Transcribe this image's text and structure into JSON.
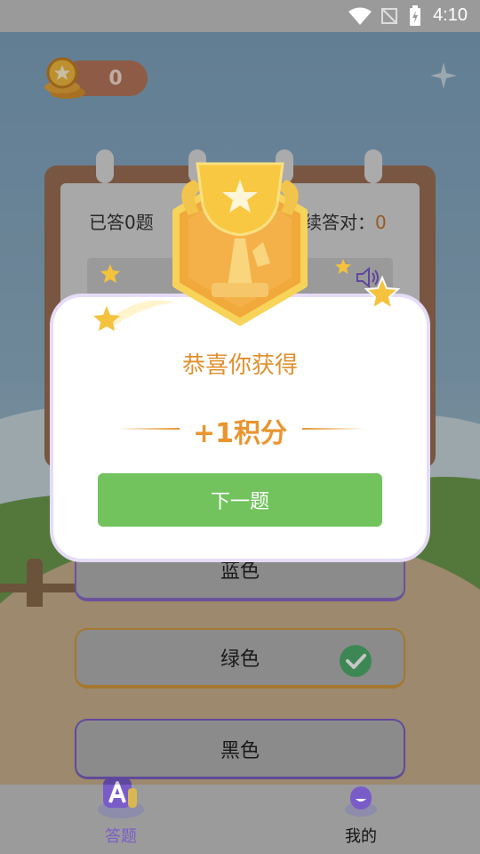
{
  "status_bar": {
    "time": "4:10"
  },
  "header": {
    "coin_count": "0"
  },
  "quiz": {
    "answered_label": "已答0题",
    "streak_label": "续答对：",
    "streak_count": "0",
    "options": [
      {
        "label": "蓝色",
        "state": "default"
      },
      {
        "label": "绿色",
        "state": "correct"
      },
      {
        "label": "黑色",
        "state": "default"
      }
    ]
  },
  "dialog": {
    "title": "恭喜你获得",
    "reward": "+1积分",
    "next_label": "下一题"
  },
  "bottom_nav": {
    "items": [
      {
        "label": "答题",
        "active": true,
        "icon": "quiz-icon"
      },
      {
        "label": "我的",
        "active": false,
        "icon": "profile-icon"
      }
    ]
  },
  "colors": {
    "accent_orange": "#e9952f",
    "next_button": "#72c35d",
    "nav_active": "#7a5cc9",
    "correct_check": "#4fae6c"
  }
}
